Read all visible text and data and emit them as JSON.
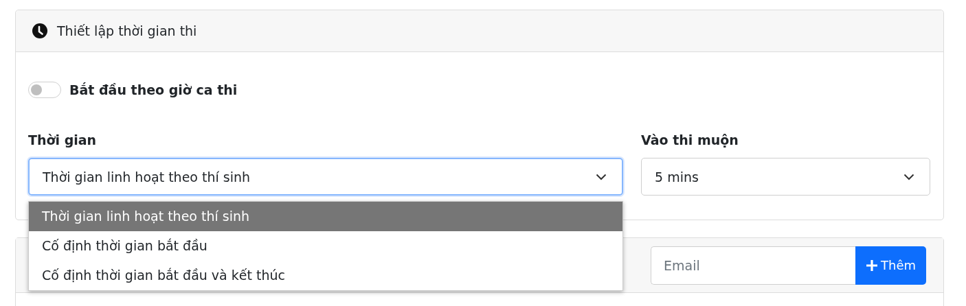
{
  "section": {
    "title": "Thiết lập thời gian thi"
  },
  "toggle": {
    "label": "Bắt đầu theo giờ ca thi",
    "on": false
  },
  "fields": [
    {
      "label": "Thời gian",
      "value": "Thời gian linh hoạt theo thí sinh",
      "focused": true,
      "expanded": true,
      "options": [
        {
          "label": "Thời gian linh hoạt theo thí sinh",
          "selected": true
        },
        {
          "label": "Cố định thời gian bắt đầu",
          "selected": false
        },
        {
          "label": "Cố định thời gian bắt đầu và kết thúc",
          "selected": false
        }
      ]
    },
    {
      "label": "Vào thi muộn",
      "value": "5 mins",
      "focused": false
    }
  ],
  "email_field": {
    "placeholder": "Email"
  },
  "add_button": {
    "label": "Thêm"
  }
}
